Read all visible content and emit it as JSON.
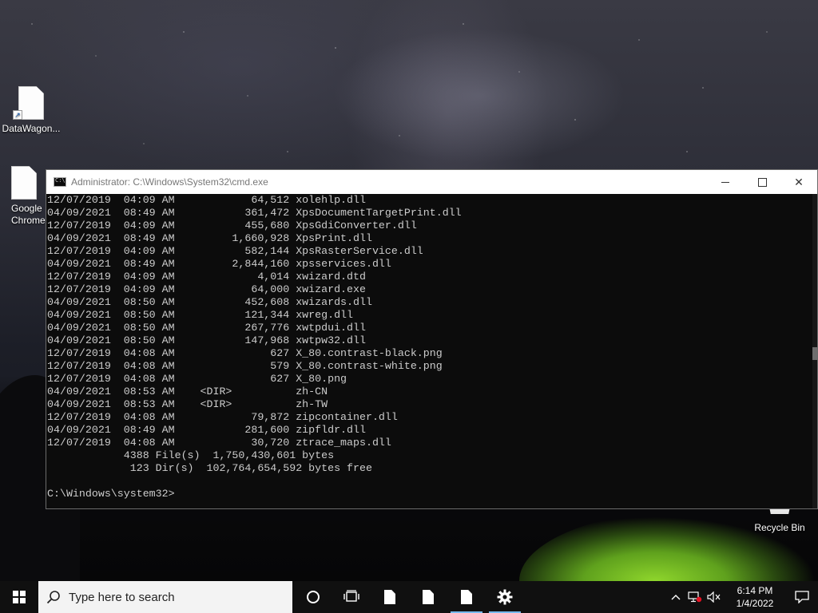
{
  "desktop": {
    "icons": [
      {
        "label": "DataWagon..."
      },
      {
        "label": "Google Chrome"
      },
      {
        "label": "Recycle Bin"
      }
    ]
  },
  "console": {
    "title": "Administrator: C:\\Windows\\System32\\cmd.exe",
    "lines": [
      "12/07/2019  04:09 AM            64,512 xolehlp.dll",
      "04/09/2021  08:49 AM           361,472 XpsDocumentTargetPrint.dll",
      "12/07/2019  04:09 AM           455,680 XpsGdiConverter.dll",
      "04/09/2021  08:49 AM         1,660,928 XpsPrint.dll",
      "12/07/2019  04:09 AM           582,144 XpsRasterService.dll",
      "04/09/2021  08:49 AM         2,844,160 xpsservices.dll",
      "12/07/2019  04:09 AM             4,014 xwizard.dtd",
      "12/07/2019  04:09 AM            64,000 xwizard.exe",
      "04/09/2021  08:50 AM           452,608 xwizards.dll",
      "04/09/2021  08:50 AM           121,344 xwreg.dll",
      "04/09/2021  08:50 AM           267,776 xwtpdui.dll",
      "04/09/2021  08:50 AM           147,968 xwtpw32.dll",
      "12/07/2019  04:08 AM               627 X_80.contrast-black.png",
      "12/07/2019  04:08 AM               579 X_80.contrast-white.png",
      "12/07/2019  04:08 AM               627 X_80.png",
      "04/09/2021  08:53 AM    <DIR>          zh-CN",
      "04/09/2021  08:53 AM    <DIR>          zh-TW",
      "12/07/2019  04:08 AM            79,872 zipcontainer.dll",
      "04/09/2021  08:49 AM           281,600 zipfldr.dll",
      "12/07/2019  04:08 AM            30,720 ztrace_maps.dll",
      "            4388 File(s)  1,750,430,601 bytes",
      "             123 Dir(s)  102,764,654,592 bytes free",
      "",
      "C:\\Windows\\system32>"
    ],
    "window_controls": {
      "minimize": "—",
      "maximize": "☐",
      "close": "✕"
    }
  },
  "taskbar": {
    "search_placeholder": "Type here to search",
    "clock_time": "6:14 PM",
    "clock_date": "1/4/2022",
    "icons": [
      "start-icon",
      "search-icon",
      "cortana-icon",
      "task-view-icon",
      "document-icon",
      "document-icon",
      "document-icon",
      "settings-gear-icon",
      "chevron-up-icon",
      "network-icon",
      "volume-muted-icon",
      "notification-icon"
    ]
  },
  "colors": {
    "console_bg": "#0c0c0c",
    "console_text": "#cccccc",
    "taskbar_bg": "#101010",
    "accent": "#76b9ed"
  }
}
